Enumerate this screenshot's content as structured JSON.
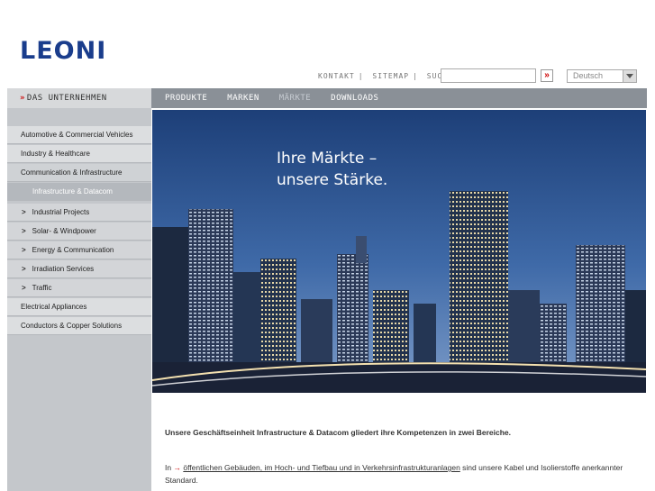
{
  "brand": {
    "logo_text": "LEONI"
  },
  "topnav": {
    "kontakt": "KONTAKT",
    "sitemap": "SITEMAP",
    "suche": "SUCHE",
    "separator": "|",
    "search_value": "",
    "search_button": "»",
    "language": "Deutsch"
  },
  "mainnav": {
    "company_arrow": "»",
    "company": "DAS UNTERNEHMEN",
    "tabs": [
      "PRODUKTE",
      "MARKEN",
      "MÄRKTE",
      "DOWNLOADS"
    ],
    "active_tab": "MÄRKTE"
  },
  "sidebar": {
    "items": [
      {
        "label": "Automotive & Commercial Vehicles"
      },
      {
        "label": "Industry & Healthcare"
      },
      {
        "label": "Communication & Infrastructure"
      },
      {
        "label": "Infrastructure & Datacom"
      },
      {
        "label": "Industrial Projects",
        "chev": ">"
      },
      {
        "label": "Solar- & Windpower",
        "chev": ">"
      },
      {
        "label": "Energy & Communication",
        "chev": ">"
      },
      {
        "label": "Irradiation Services",
        "chev": ">"
      },
      {
        "label": "Traffic",
        "chev": ">"
      },
      {
        "label": "Electrical Appliances"
      },
      {
        "label": "Conductors & Copper Solutions"
      }
    ]
  },
  "hero": {
    "line1": "Ihre Märkte –",
    "line2": "unsere Stärke."
  },
  "content": {
    "intro": "Unsere Geschäftseinheit Infrastructure & Datacom gliedert ihre Kompetenzen in zwei Bereiche.",
    "para_prefix": "In",
    "para_arrow": "→",
    "para_link": "öffentlichen Gebäuden, im Hoch- und Tiefbau und in Verkehrsinfrastrukturanlagen",
    "para_suffix": "sind unsere Kabel und Isolierstoffe anerkannter Standard."
  },
  "colors": {
    "brand": "#1a3d8c",
    "accent": "#cc0000",
    "navbar": "#8a9097",
    "sidebar": "#c4c7cb"
  }
}
